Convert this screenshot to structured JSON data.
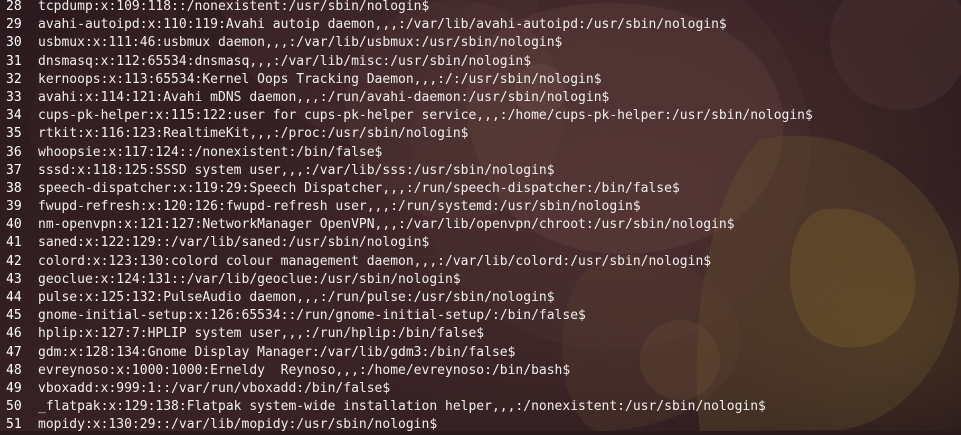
{
  "editor": {
    "lines": [
      {
        "number": "28",
        "text": "tcpdump:x:109:118::/nonexistent:/usr/sbin/nologin$"
      },
      {
        "number": "29",
        "text": "avahi-autoipd:x:110:119:Avahi autoip daemon,,,:/var/lib/avahi-autoipd:/usr/sbin/nologin$"
      },
      {
        "number": "30",
        "text": "usbmux:x:111:46:usbmux daemon,,,:/var/lib/usbmux:/usr/sbin/nologin$"
      },
      {
        "number": "31",
        "text": "dnsmasq:x:112:65534:dnsmasq,,,:/var/lib/misc:/usr/sbin/nologin$"
      },
      {
        "number": "32",
        "text": "kernoops:x:113:65534:Kernel Oops Tracking Daemon,,,:/:/usr/sbin/nologin$"
      },
      {
        "number": "33",
        "text": "avahi:x:114:121:Avahi mDNS daemon,,,:/run/avahi-daemon:/usr/sbin/nologin$"
      },
      {
        "number": "34",
        "text": "cups-pk-helper:x:115:122:user for cups-pk-helper service,,,:/home/cups-pk-helper:/usr/sbin/nologin$"
      },
      {
        "number": "35",
        "text": "rtkit:x:116:123:RealtimeKit,,,:/proc:/usr/sbin/nologin$"
      },
      {
        "number": "36",
        "text": "whoopsie:x:117:124::/nonexistent:/bin/false$"
      },
      {
        "number": "37",
        "text": "sssd:x:118:125:SSSD system user,,,:/var/lib/sss:/usr/sbin/nologin$"
      },
      {
        "number": "38",
        "text": "speech-dispatcher:x:119:29:Speech Dispatcher,,,:/run/speech-dispatcher:/bin/false$"
      },
      {
        "number": "39",
        "text": "fwupd-refresh:x:120:126:fwupd-refresh user,,,:/run/systemd:/usr/sbin/nologin$"
      },
      {
        "number": "40",
        "text": "nm-openvpn:x:121:127:NetworkManager OpenVPN,,,:/var/lib/openvpn/chroot:/usr/sbin/nologin$"
      },
      {
        "number": "41",
        "text": "saned:x:122:129::/var/lib/saned:/usr/sbin/nologin$"
      },
      {
        "number": "42",
        "text": "colord:x:123:130:colord colour management daemon,,,:/var/lib/colord:/usr/sbin/nologin$"
      },
      {
        "number": "43",
        "text": "geoclue:x:124:131::/var/lib/geoclue:/usr/sbin/nologin$"
      },
      {
        "number": "44",
        "text": "pulse:x:125:132:PulseAudio daemon,,,:/run/pulse:/usr/sbin/nologin$"
      },
      {
        "number": "45",
        "text": "gnome-initial-setup:x:126:65534::/run/gnome-initial-setup/:/bin/false$"
      },
      {
        "number": "46",
        "text": "hplip:x:127:7:HPLIP system user,,,:/run/hplip:/bin/false$"
      },
      {
        "number": "47",
        "text": "gdm:x:128:134:Gnome Display Manager:/var/lib/gdm3:/bin/false$"
      },
      {
        "number": "48",
        "text": "evreynoso:x:1000:1000:Erneldy  Reynoso,,,:/home/evreynoso:/bin/bash$"
      },
      {
        "number": "49",
        "text": "vboxadd:x:999:1::/var/run/vboxadd:/bin/false$"
      },
      {
        "number": "50",
        "text": "_flatpak:x:129:138:Flatpak system-wide installation helper,,,:/nonexistent:/usr/sbin/nologin$"
      },
      {
        "number": "51",
        "text": "mopidy:x:130:29::/var/lib/mopidy:/usr/sbin/nologin$"
      }
    ]
  },
  "colors": {
    "background": "#2a1a1c",
    "text": "#ffffff"
  }
}
